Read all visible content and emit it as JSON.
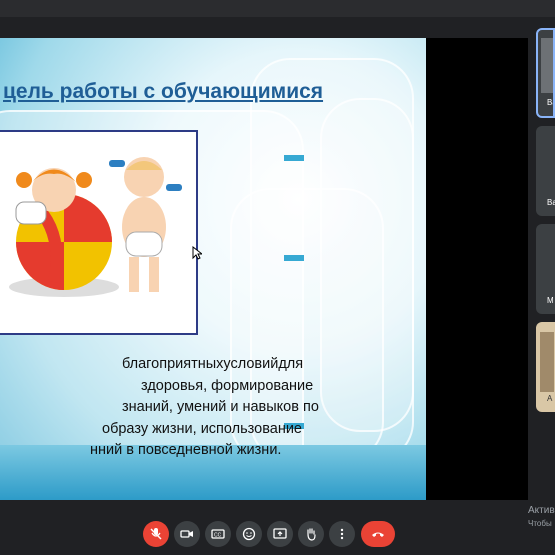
{
  "slide": {
    "title": "цель работы с обучающимися",
    "body_lines": [
      [
        "благоприятных",
        "условий",
        "для"
      ],
      "здоровья,           формирование",
      "знаний, умений и навыков по",
      "образу жизни, использование",
      "нний в повседневной жизни."
    ]
  },
  "participants": [
    {
      "label": "Ва",
      "active": true
    },
    {
      "label": "Ва",
      "active": false
    },
    {
      "label": "М",
      "active": false
    },
    {
      "label": "А",
      "active": false
    }
  ],
  "watermark": {
    "line1": "Актив",
    "line2": "Чтобы"
  },
  "toolbar": {
    "buttons": [
      "mic-off-icon",
      "camera-icon",
      "captions-icon",
      "emoji-icon",
      "present-icon",
      "raise-hand-icon",
      "more-icon",
      "end-call-icon"
    ]
  },
  "colors": {
    "mic_off": "#ea4335",
    "end_call": "#ea4335",
    "title": "#1f5e96",
    "active_tile_border": "#8ab4f8"
  }
}
